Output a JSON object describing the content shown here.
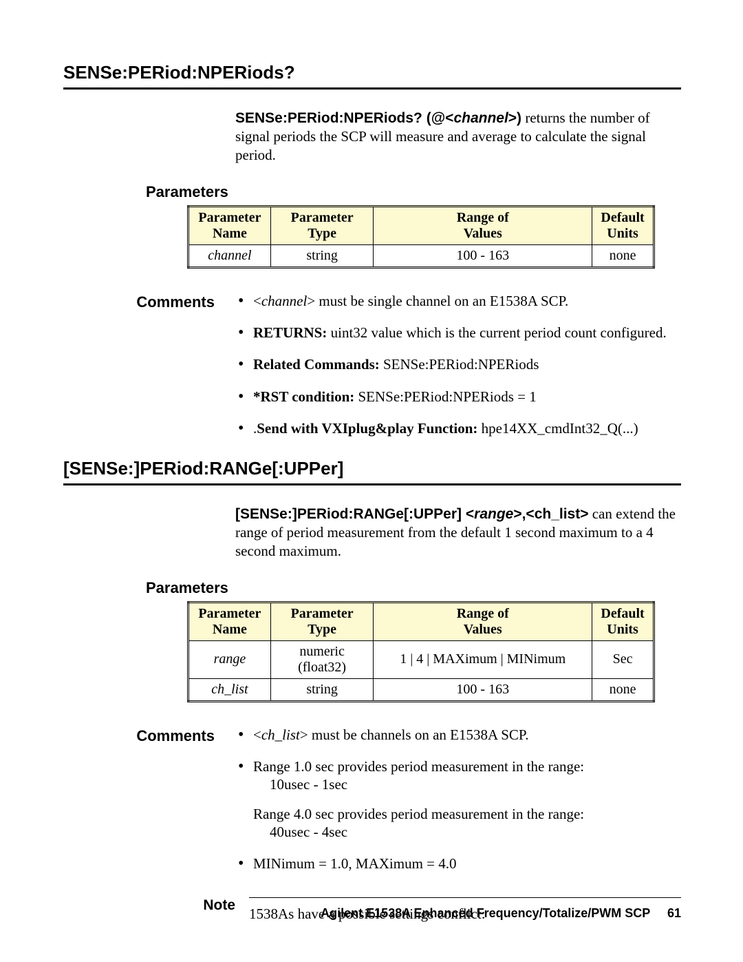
{
  "section1": {
    "heading": "SENSe:PERiod:NPERiods?",
    "cmd_name": "SENSe:PERiod:NPERiods?  (@<",
    "cmd_arg": "channel",
    "cmd_after_arg": ">)",
    "desc_rest": " returns the number of signal periods the SCP will measure and average to calculate the signal period.",
    "params_label": "Parameters",
    "table": {
      "headers": {
        "c1a": "Parameter",
        "c1b": "Name",
        "c2a": "Parameter",
        "c2b": "Type",
        "c3a": "Range of",
        "c3b": "Values",
        "c4a": "Default",
        "c4b": "Units"
      },
      "rows": [
        {
          "name": "channel",
          "type": "string",
          "range": "100 - 163",
          "units": "none"
        }
      ]
    },
    "comments_label": "Comments",
    "comments": {
      "li1_pre": "<",
      "li1_italic": "channel",
      "li1_post": "> must be single channel on an E1538A SCP.",
      "li2_bold": "RETURNS:",
      "li2_rest": " uint32 value which is the current period count configured.",
      "li3_bold": "Related Commands:",
      "li3_rest": "  SENSe:PERiod:NPERiods",
      "li4_bold": "*RST condition:",
      "li4_rest": "  SENSe:PERiod:NPERiods = 1",
      "li5_pre": ".",
      "li5_bold": "Send with VXIplug&play Function:",
      "li5_rest": " hpe14XX_cmdInt32_Q(...)"
    }
  },
  "section2": {
    "heading": "[SENSe:]PERiod:RANGe[:UPPer]",
    "cmd_name": "[SENSe:]PERiod:RANGe[:UPPer]  <",
    "cmd_arg": "range",
    "cmd_mid": ">,<ch_list>",
    "desc_rest": " can extend the range of period measurement from the default 1 second maximum to a 4 second maximum.",
    "params_label": "Parameters",
    "table": {
      "headers": {
        "c1a": "Parameter",
        "c1b": "Name",
        "c2a": "Parameter",
        "c2b": "Type",
        "c3a": "Range of",
        "c3b": "Values",
        "c4a": "Default",
        "c4b": "Units"
      },
      "rows": [
        {
          "name": "range",
          "type": "numeric (float32)",
          "range": "1 | 4 | MAXimum | MINimum",
          "units": "Sec"
        },
        {
          "name": "ch_list",
          "type": "string",
          "range": "100 - 163",
          "units": "none"
        }
      ]
    },
    "comments_label": "Comments",
    "comments": {
      "li1_pre": "<",
      "li1_italic": "ch_list",
      "li1_post": "> must be channels on an E1538A SCP.",
      "li2_line1": "Range 1.0 sec provides period measurement in the range:",
      "li2_sub1": "10usec - 1sec",
      "li2_line2": "Range 4.0 sec provides period measurement in the range:",
      "li2_sub2": "40usec - 4sec",
      "li3": "MINimum = 1.0, MAXimum = 4.0"
    },
    "note_label": "Note",
    "note_text": "1538As have a possible settings conflict:"
  },
  "footer": {
    "title": "Agilent E1538A Enhanced Frequency/Totalize/PWM SCP",
    "page": "61"
  }
}
